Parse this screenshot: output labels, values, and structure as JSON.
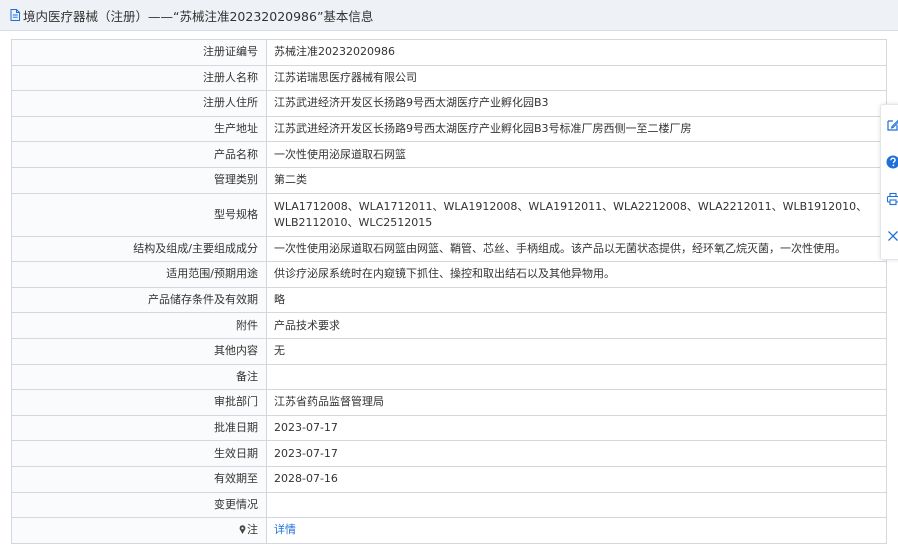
{
  "header": {
    "title": "境内医疗器械（注册）——“苏械注准20232020986”基本信息",
    "icon": "document-icon"
  },
  "rows": [
    {
      "label": "注册证编号",
      "value": "苏械注准20232020986"
    },
    {
      "label": "注册人名称",
      "value": "江苏诺瑞思医疗器械有限公司"
    },
    {
      "label": "注册人住所",
      "value": "江苏武进经济开发区长扬路9号西太湖医疗产业孵化园B3"
    },
    {
      "label": "生产地址",
      "value": "江苏武进经济开发区长扬路9号西太湖医疗产业孵化园B3号标准厂房西侧一至二楼厂房"
    },
    {
      "label": "产品名称",
      "value": "一次性使用泌尿道取石网篮"
    },
    {
      "label": "管理类别",
      "value": "第二类"
    },
    {
      "label": "型号规格",
      "value": "WLA1712008、WLA1712011、WLA1912008、WLA1912011、WLA2212008、WLA2212011、WLB1912010、WLB2112010、WLC2512015"
    },
    {
      "label": "结构及组成/主要组成成分",
      "value": "一次性使用泌尿道取石网篮由网篮、鞘管、芯丝、手柄组成。该产品以无菌状态提供，经环氧乙烷灭菌，一次性使用。"
    },
    {
      "label": "适用范围/预期用途",
      "value": "供诊疗泌尿系统时在内窥镜下抓住、操控和取出结石以及其他异物用。"
    },
    {
      "label": "产品储存条件及有效期",
      "value": "略"
    },
    {
      "label": "附件",
      "value": "产品技术要求"
    },
    {
      "label": "其他内容",
      "value": "无"
    },
    {
      "label": "备注",
      "value": ""
    },
    {
      "label": "审批部门",
      "value": "江苏省药品监督管理局"
    },
    {
      "label": "批准日期",
      "value": "2023-07-17"
    },
    {
      "label": "生效日期",
      "value": "2023-07-17"
    },
    {
      "label": "有效期至",
      "value": "2028-07-16"
    },
    {
      "label": "变更情况",
      "value": ""
    }
  ],
  "note_row": {
    "label": "注",
    "link": "详情",
    "icon": "pin-icon"
  },
  "sidebar": {
    "icons": [
      "edit-icon",
      "help-icon",
      "print-icon",
      "close-icon"
    ],
    "accent": "#1e6fd9"
  }
}
